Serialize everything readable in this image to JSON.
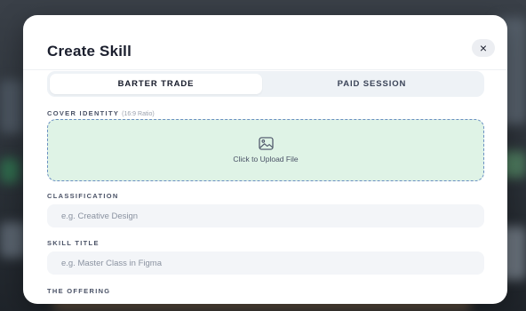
{
  "modal": {
    "title": "Create Skill",
    "close_label": "×"
  },
  "tabs": [
    {
      "label": "BARTER TRADE",
      "active": true
    },
    {
      "label": "PAID SESSION",
      "active": false
    }
  ],
  "cover": {
    "label": "COVER IDENTITY",
    "hint": "(16:9 Ratio)",
    "upload_text": "Click to Upload File",
    "icon": "image-icon"
  },
  "classification": {
    "label": "CLASSIFICATION",
    "placeholder": "e.g. Creative Design",
    "value": ""
  },
  "skill_title": {
    "label": "SKILL TITLE",
    "placeholder": "e.g. Master Class in Figma",
    "value": ""
  },
  "offering": {
    "label": "THE OFFERING"
  },
  "colors": {
    "upload_bg": "#dff3e6",
    "upload_border": "#6a8fc2",
    "title": "#1b1f2e"
  }
}
